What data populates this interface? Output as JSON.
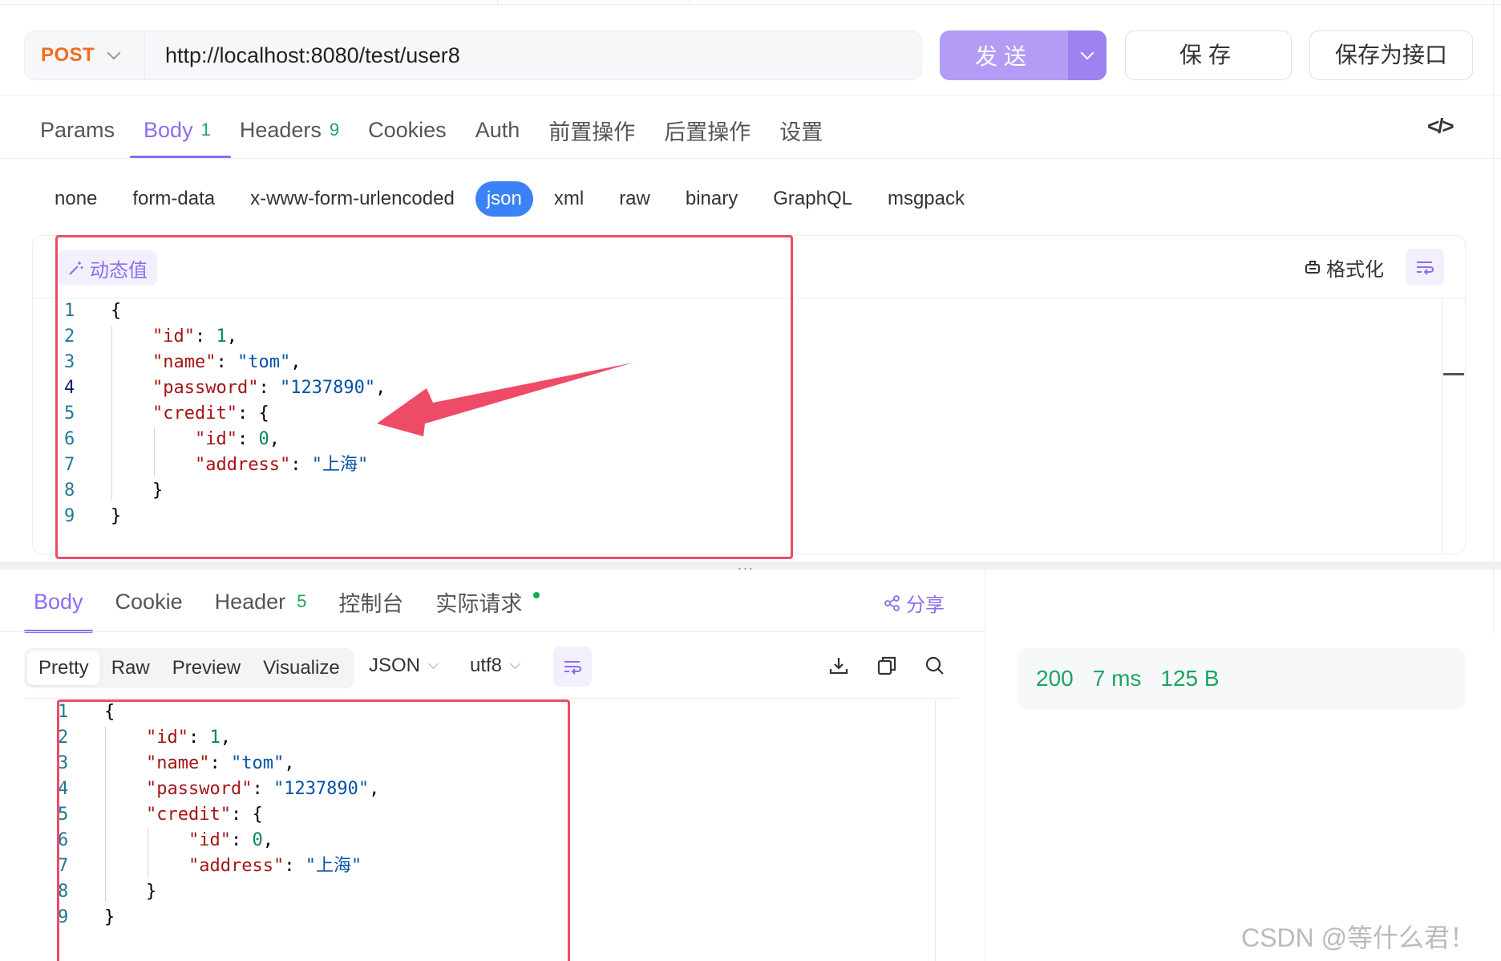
{
  "request": {
    "method": "POST",
    "url": "http://localhost:8080/test/user8",
    "send_label": "发送",
    "save_label": "保存",
    "save_api_label": "保存为接口"
  },
  "request_tabs": [
    {
      "label": "Params",
      "badge": ""
    },
    {
      "label": "Body",
      "badge": "1"
    },
    {
      "label": "Headers",
      "badge": "9"
    },
    {
      "label": "Cookies",
      "badge": ""
    },
    {
      "label": "Auth",
      "badge": ""
    },
    {
      "label": "前置操作",
      "badge": ""
    },
    {
      "label": "后置操作",
      "badge": ""
    },
    {
      "label": "设置",
      "badge": ""
    }
  ],
  "code_icon_label": "</>",
  "body_types": [
    "none",
    "form-data",
    "x-www-form-urlencoded",
    "json",
    "xml",
    "raw",
    "binary",
    "GraphQL",
    "msgpack"
  ],
  "body_active": "json",
  "editor": {
    "dynamic_label": "动态值",
    "format_label": "格式化",
    "line_numbers": [
      "1",
      "2",
      "3",
      "4",
      "5",
      "6",
      "7",
      "8",
      "9"
    ],
    "json": {
      "id_key": "\"id\"",
      "id_val": "1",
      "name_key": "\"name\"",
      "name_val": "\"tom\"",
      "password_key": "\"password\"",
      "password_val": "\"1237890\"",
      "credit_key": "\"credit\"",
      "credit_id_key": "\"id\"",
      "credit_id_val": "0",
      "address_key": "\"address\"",
      "address_val": "\"上海\""
    }
  },
  "splitter_dots": "...",
  "response_tabs": [
    {
      "label": "Body",
      "badge": ""
    },
    {
      "label": "Cookie",
      "badge": ""
    },
    {
      "label": "Header",
      "badge": "5"
    },
    {
      "label": "控制台",
      "badge": ""
    },
    {
      "label": "实际请求",
      "badge": ""
    }
  ],
  "share_label": "分享",
  "view_options": [
    "Pretty",
    "Raw",
    "Preview",
    "Visualize"
  ],
  "format_select": "JSON",
  "encoding_select": "utf8",
  "status": {
    "code": "200",
    "time": "7 ms",
    "size": "125 B"
  },
  "watermark": "CSDN @等什么君！",
  "colors": {
    "accent": "#8d6cf0",
    "method": "#f26b1d",
    "success": "#1aa55f",
    "highlight": "#ee4b67"
  }
}
